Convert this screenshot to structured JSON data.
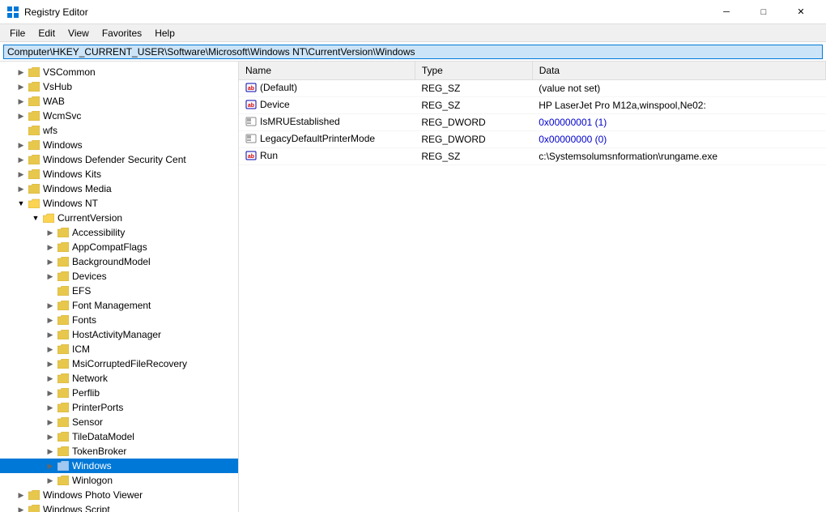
{
  "app": {
    "title": "Registry Editor",
    "icon": "regedit"
  },
  "titlebar": {
    "minimize_label": "─",
    "maximize_label": "□",
    "close_label": "✕"
  },
  "menubar": {
    "items": [
      {
        "id": "file",
        "label": "File"
      },
      {
        "id": "edit",
        "label": "Edit"
      },
      {
        "id": "view",
        "label": "View"
      },
      {
        "id": "favorites",
        "label": "Favorites"
      },
      {
        "id": "help",
        "label": "Help"
      }
    ]
  },
  "addressbar": {
    "value": "Computer\\HKEY_CURRENT_USER\\Software\\Microsoft\\Windows NT\\CurrentVersion\\Windows"
  },
  "tree": {
    "items": [
      {
        "id": "vscommon",
        "label": "VSCommon",
        "indent": 1,
        "expanded": false,
        "selected": false,
        "hasChildren": true
      },
      {
        "id": "vshub",
        "label": "VsHub",
        "indent": 1,
        "expanded": false,
        "selected": false,
        "hasChildren": true
      },
      {
        "id": "wab",
        "label": "WAB",
        "indent": 1,
        "expanded": false,
        "selected": false,
        "hasChildren": true
      },
      {
        "id": "wcmsvc",
        "label": "WcmSvc",
        "indent": 1,
        "expanded": false,
        "selected": false,
        "hasChildren": true
      },
      {
        "id": "wfs",
        "label": "wfs",
        "indent": 1,
        "expanded": false,
        "selected": false,
        "hasChildren": false
      },
      {
        "id": "windows",
        "label": "Windows",
        "indent": 1,
        "expanded": false,
        "selected": false,
        "hasChildren": true
      },
      {
        "id": "windefender",
        "label": "Windows Defender Security Cent",
        "indent": 1,
        "expanded": false,
        "selected": false,
        "hasChildren": true
      },
      {
        "id": "winskits",
        "label": "Windows Kits",
        "indent": 1,
        "expanded": false,
        "selected": false,
        "hasChildren": true
      },
      {
        "id": "winsmedia",
        "label": "Windows Media",
        "indent": 1,
        "expanded": false,
        "selected": false,
        "hasChildren": true
      },
      {
        "id": "winsnt",
        "label": "Windows NT",
        "indent": 1,
        "expanded": true,
        "selected": false,
        "hasChildren": true
      },
      {
        "id": "currentversion",
        "label": "CurrentVersion",
        "indent": 2,
        "expanded": true,
        "selected": false,
        "hasChildren": true
      },
      {
        "id": "accessibility",
        "label": "Accessibility",
        "indent": 3,
        "expanded": false,
        "selected": false,
        "hasChildren": true
      },
      {
        "id": "appcompatflags",
        "label": "AppCompatFlags",
        "indent": 3,
        "expanded": false,
        "selected": false,
        "hasChildren": true
      },
      {
        "id": "backgroundmodel",
        "label": "BackgroundModel",
        "indent": 3,
        "expanded": false,
        "selected": false,
        "hasChildren": true
      },
      {
        "id": "devices",
        "label": "Devices",
        "indent": 3,
        "expanded": false,
        "selected": false,
        "hasChildren": true
      },
      {
        "id": "efs",
        "label": "EFS",
        "indent": 3,
        "expanded": false,
        "selected": false,
        "hasChildren": false
      },
      {
        "id": "fontmanagement",
        "label": "Font Management",
        "indent": 3,
        "expanded": false,
        "selected": false,
        "hasChildren": true
      },
      {
        "id": "fonts",
        "label": "Fonts",
        "indent": 3,
        "expanded": false,
        "selected": false,
        "hasChildren": true
      },
      {
        "id": "hostactivitymanager",
        "label": "HostActivityManager",
        "indent": 3,
        "expanded": false,
        "selected": false,
        "hasChildren": true
      },
      {
        "id": "icm",
        "label": "ICM",
        "indent": 3,
        "expanded": false,
        "selected": false,
        "hasChildren": true
      },
      {
        "id": "msicorruptedfilerecovery",
        "label": "MsiCorruptedFileRecovery",
        "indent": 3,
        "expanded": false,
        "selected": false,
        "hasChildren": true
      },
      {
        "id": "network",
        "label": "Network",
        "indent": 3,
        "expanded": false,
        "selected": false,
        "hasChildren": true
      },
      {
        "id": "perflib",
        "label": "Perflib",
        "indent": 3,
        "expanded": false,
        "selected": false,
        "hasChildren": true
      },
      {
        "id": "printerports",
        "label": "PrinterPorts",
        "indent": 3,
        "expanded": false,
        "selected": false,
        "hasChildren": true
      },
      {
        "id": "sensor",
        "label": "Sensor",
        "indent": 3,
        "expanded": false,
        "selected": false,
        "hasChildren": true
      },
      {
        "id": "tiledatamodel",
        "label": "TileDataModel",
        "indent": 3,
        "expanded": false,
        "selected": false,
        "hasChildren": true
      },
      {
        "id": "tokenbroker",
        "label": "TokenBroker",
        "indent": 3,
        "expanded": false,
        "selected": false,
        "hasChildren": true
      },
      {
        "id": "windows-sub",
        "label": "Windows",
        "indent": 3,
        "expanded": false,
        "selected": true,
        "hasChildren": true
      },
      {
        "id": "winlogon",
        "label": "Winlogon",
        "indent": 3,
        "expanded": false,
        "selected": false,
        "hasChildren": true
      },
      {
        "id": "winphotoviewer",
        "label": "Windows Photo Viewer",
        "indent": 1,
        "expanded": false,
        "selected": false,
        "hasChildren": true
      },
      {
        "id": "winscript",
        "label": "Windows Script",
        "indent": 1,
        "expanded": false,
        "selected": false,
        "hasChildren": true
      }
    ]
  },
  "registry": {
    "columns": {
      "name": "Name",
      "type": "Type",
      "data": "Data"
    },
    "rows": [
      {
        "id": "default",
        "icon": "reg_sz",
        "name": "(Default)",
        "type": "REG_SZ",
        "data": "(value not set)",
        "data_colored": false
      },
      {
        "id": "device",
        "icon": "reg_sz",
        "name": "Device",
        "type": "REG_SZ",
        "data": "HP LaserJet Pro M12a,winspool,Ne02:",
        "data_colored": false
      },
      {
        "id": "ismruestablished",
        "icon": "reg_dword",
        "name": "IsMRUEstablished",
        "type": "REG_DWORD",
        "data": "0x00000001 (1)",
        "data_colored": true
      },
      {
        "id": "legacydefaultprintermode",
        "icon": "reg_dword",
        "name": "LegacyDefaultPrinterMode",
        "type": "REG_DWORD",
        "data": "0x00000000 (0)",
        "data_colored": true
      },
      {
        "id": "run",
        "icon": "reg_sz",
        "name": "Run",
        "type": "REG_SZ",
        "data": "c:\\Systemsolumsnformation\\rungame.exe",
        "data_colored": false
      }
    ]
  }
}
